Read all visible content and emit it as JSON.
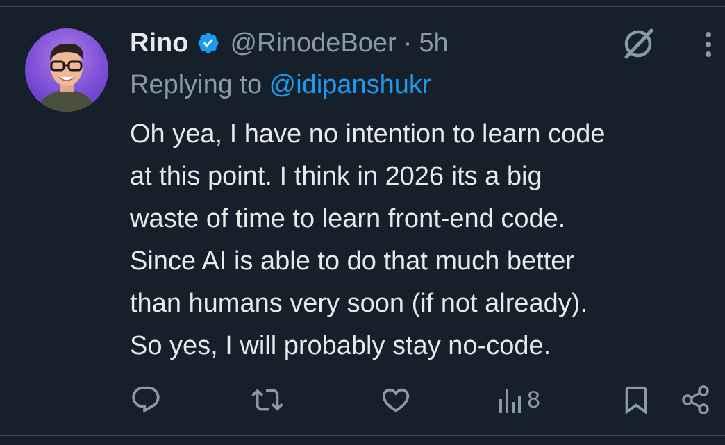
{
  "tweet": {
    "display_name": "Rino",
    "handle": "@RinodeBoer",
    "separator": "·",
    "time": "5h",
    "replying_prefix": "Replying to ",
    "replying_to": "@idipanshukr",
    "text_lines": [
      "Oh yea, I have no intention to learn code",
      "at this point. I think in 2026 its a big",
      "waste of time to learn front-end code.",
      "Since AI is able to do that much better",
      "than humans very soon (if not already).",
      "So yes, I will probably stay no-code."
    ],
    "views": "8"
  },
  "icons": {
    "verified": "verified-badge-icon",
    "grok": "grok-icon",
    "more": "more-vertical-icon",
    "reply": "reply-icon",
    "retweet": "retweet-icon",
    "like": "heart-icon",
    "views": "views-chart-icon",
    "bookmark": "bookmark-icon",
    "share": "share-icon"
  },
  "colors": {
    "background": "#15202b",
    "text": "#e7e9ea",
    "secondary": "#8b98a5",
    "accent": "#1d9bf0",
    "verified": "#1d9bf0"
  }
}
